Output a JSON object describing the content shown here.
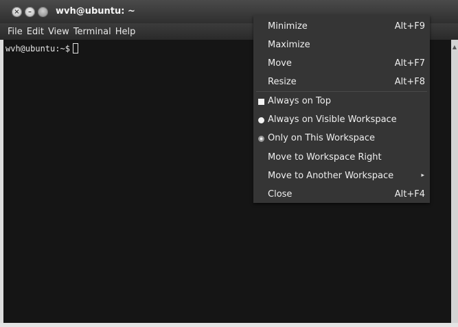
{
  "window": {
    "title": "wvh@ubuntu: ~",
    "buttons": {
      "close": "×",
      "minimize": "–"
    }
  },
  "menubar": [
    "File",
    "Edit",
    "View",
    "Terminal",
    "Help"
  ],
  "terminal": {
    "prompt": "wvh@ubuntu:~$"
  },
  "context_menu": {
    "items": [
      {
        "label": "Minimize",
        "accel": "Alt+F9"
      },
      {
        "label": "Maximize",
        "accel": ""
      },
      {
        "label": "Move",
        "accel": "Alt+F7"
      },
      {
        "label": "Resize",
        "accel": "Alt+F8"
      },
      {
        "label": "Always on Top",
        "accel": ""
      },
      {
        "label": "Always on Visible Workspace",
        "accel": ""
      },
      {
        "label": "Only on This Workspace",
        "accel": ""
      },
      {
        "label": "Move to Workspace Right",
        "accel": ""
      },
      {
        "label": "Move to Another Workspace",
        "accel": "",
        "submenu": "▸"
      },
      {
        "label": "Close",
        "accel": "Alt+F4"
      }
    ]
  },
  "colors": {
    "titlebar": "#333333",
    "terminal_bg": "#151515",
    "menu_bg": "#353535",
    "menu_text": "#efefef"
  }
}
